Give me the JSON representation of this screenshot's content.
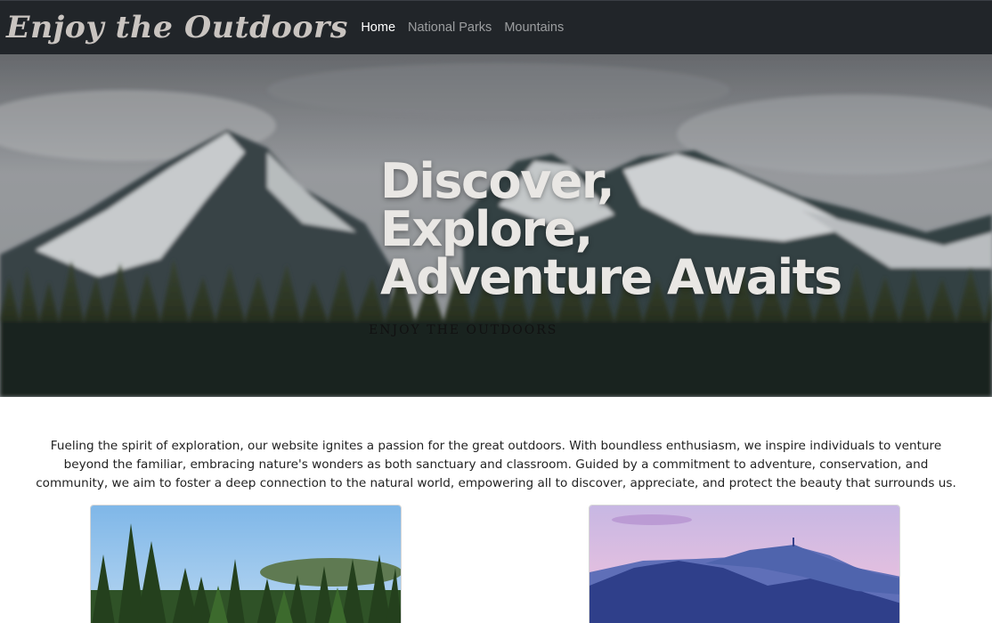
{
  "navbar": {
    "brand": "Enjoy the Outdoors",
    "links": [
      {
        "label": "Home",
        "active": true
      },
      {
        "label": "National Parks",
        "active": false
      },
      {
        "label": "Mountains",
        "active": false
      }
    ],
    "colors": {
      "background": "#212529",
      "brand": "#c9c4c0",
      "active_link": "#ffffff",
      "link": "#8c8f93"
    }
  },
  "hero": {
    "title_lines": [
      "Discover,",
      "Explore,",
      "Adventure Awaits"
    ],
    "subtitle": "ENJOY THE OUTDOORS",
    "image": "snowy-mountains-forest-image"
  },
  "intro": {
    "text": "Fueling the spirit of exploration, our website ignites a passion for the great outdoors. With boundless enthusiasm, we inspire individuals to venture beyond the familiar, embracing nature's wonders as both sanctuary and classroom. Guided by a commitment to adventure, conservation, and community, we aim to foster a deep connection to the natural world, empowering all to discover, appreciate, and protect the beauty that surrounds us."
  },
  "cards": [
    {
      "image": "forest-pine-trees-image"
    },
    {
      "image": "purple-mountain-sunset-image"
    }
  ]
}
